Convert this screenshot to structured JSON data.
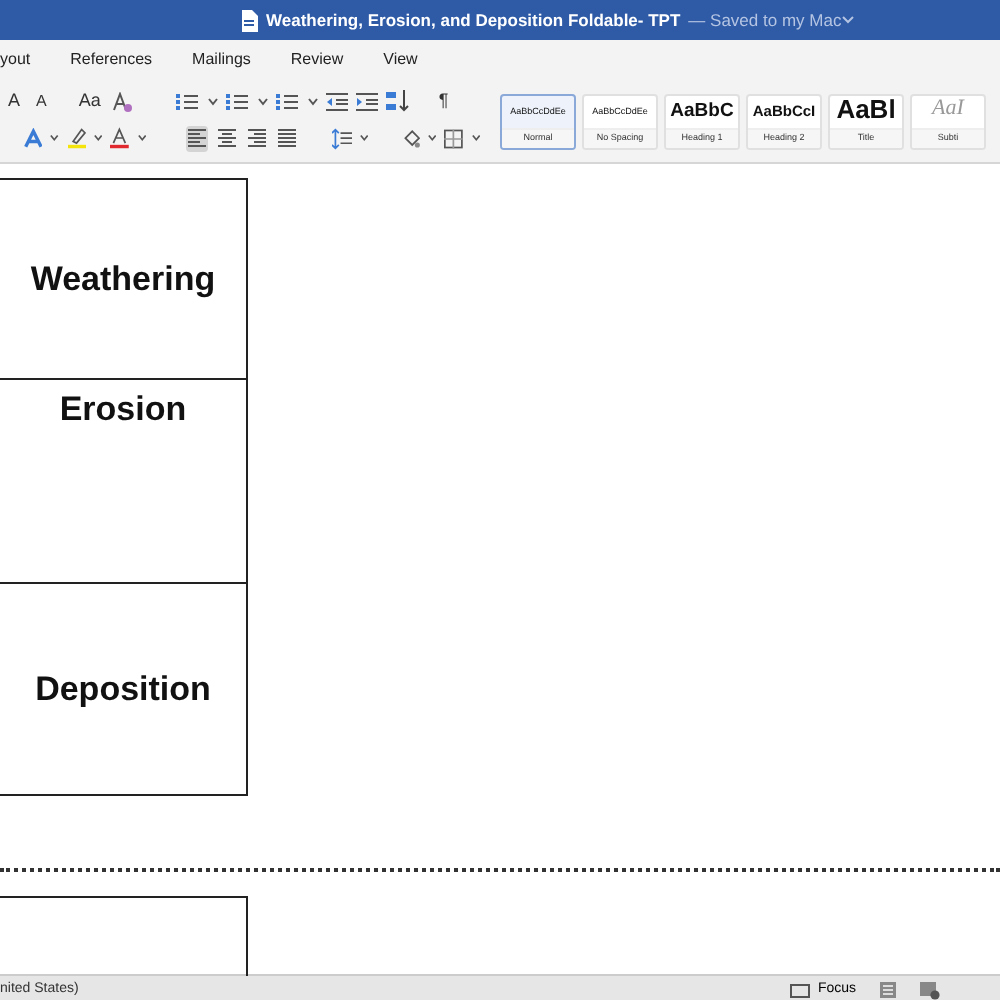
{
  "window": {
    "title": "Weathering, Erosion, and Deposition Foldable- TPT",
    "save_status": "— Saved to my Mac"
  },
  "menu_tabs": [
    {
      "label": "yout",
      "selected": false
    },
    {
      "label": "References",
      "selected": false
    },
    {
      "label": "Mailings",
      "selected": false
    },
    {
      "label": "Review",
      "selected": false
    },
    {
      "label": "View",
      "selected": false
    }
  ],
  "ribbon": {
    "font_buttons": [
      "A",
      "A",
      "Aa"
    ],
    "paragraph_mark": "¶",
    "alignment": [
      {
        "kind": "left",
        "selected": true
      },
      {
        "kind": "center",
        "selected": false
      },
      {
        "kind": "right",
        "selected": false
      },
      {
        "kind": "justify",
        "selected": false
      }
    ],
    "styles": [
      {
        "preview": "AaBbCcDdEe",
        "name": "Normal",
        "kind": "normal",
        "selected": true
      },
      {
        "preview": "AaBbCcDdEe",
        "name": "No Spacing",
        "kind": "normal",
        "selected": false
      },
      {
        "preview": "AaBbC",
        "name": "Heading 1",
        "kind": "heading1",
        "selected": false
      },
      {
        "preview": "AaBbCcI",
        "name": "Heading 2",
        "kind": "heading2",
        "selected": false
      },
      {
        "preview": "AaBl",
        "name": "Title",
        "kind": "title",
        "selected": false
      },
      {
        "preview": "AaI",
        "name": "Subti",
        "kind": "subtitle",
        "selected": false
      }
    ]
  },
  "document": {
    "table_cells": [
      {
        "text": "Weathering",
        "kind": "middle"
      },
      {
        "text": "Erosion",
        "kind": "top"
      },
      {
        "text": "Deposition",
        "kind": "middle"
      }
    ]
  },
  "status_bar": {
    "language": "nited States)",
    "focus": "Focus"
  }
}
